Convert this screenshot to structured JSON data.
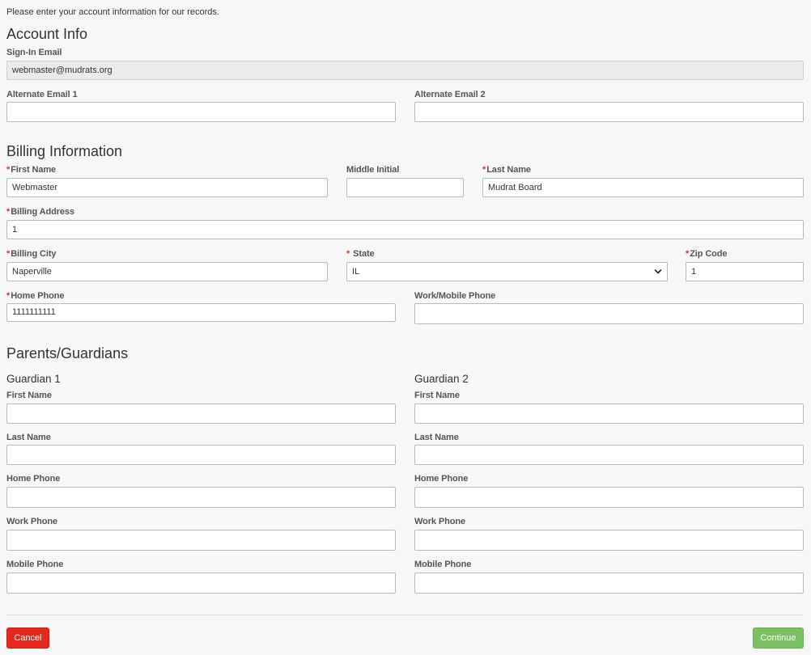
{
  "intro": "Please enter your account information for our records.",
  "account": {
    "heading": "Account Info",
    "signin_label": "Sign-In Email",
    "signin_value": "webmaster@mudrats.org",
    "alt1_label": "Alternate Email 1",
    "alt1_value": "",
    "alt2_label": "Alternate Email 2",
    "alt2_value": ""
  },
  "billing": {
    "heading": "Billing Information",
    "required_mark": "*",
    "first_name_label": "First Name",
    "first_name_value": "Webmaster",
    "middle_initial_label": "Middle Initial",
    "middle_initial_value": "",
    "last_name_label": "Last Name",
    "last_name_value": "Mudrat Board",
    "address_label": "Billing Address",
    "address_value": "1",
    "city_label": "Billing City",
    "city_value": "Naperville",
    "state_label": "State",
    "state_value": "IL",
    "zip_label": "Zip Code",
    "zip_value": "1",
    "home_phone_label": "Home Phone",
    "home_phone_value": "1111111111",
    "work_phone_label": "Work/Mobile Phone",
    "work_phone_value": ""
  },
  "guardians": {
    "heading": "Parents/Guardians",
    "g1": {
      "title": "Guardian 1",
      "first_name_label": "First Name",
      "last_name_label": "Last Name",
      "home_phone_label": "Home Phone",
      "work_phone_label": "Work Phone",
      "mobile_phone_label": "Mobile Phone"
    },
    "g2": {
      "title": "Guardian 2",
      "first_name_label": "First Name",
      "last_name_label": "Last Name",
      "home_phone_label": "Home Phone",
      "work_phone_label": "Work Phone",
      "mobile_phone_label": "Mobile Phone"
    }
  },
  "actions": {
    "cancel_label": "Cancel",
    "continue_label": "Continue"
  },
  "colors": {
    "required": "#d9312b",
    "cancel": "#e5291e",
    "continue": "#7bc063"
  }
}
